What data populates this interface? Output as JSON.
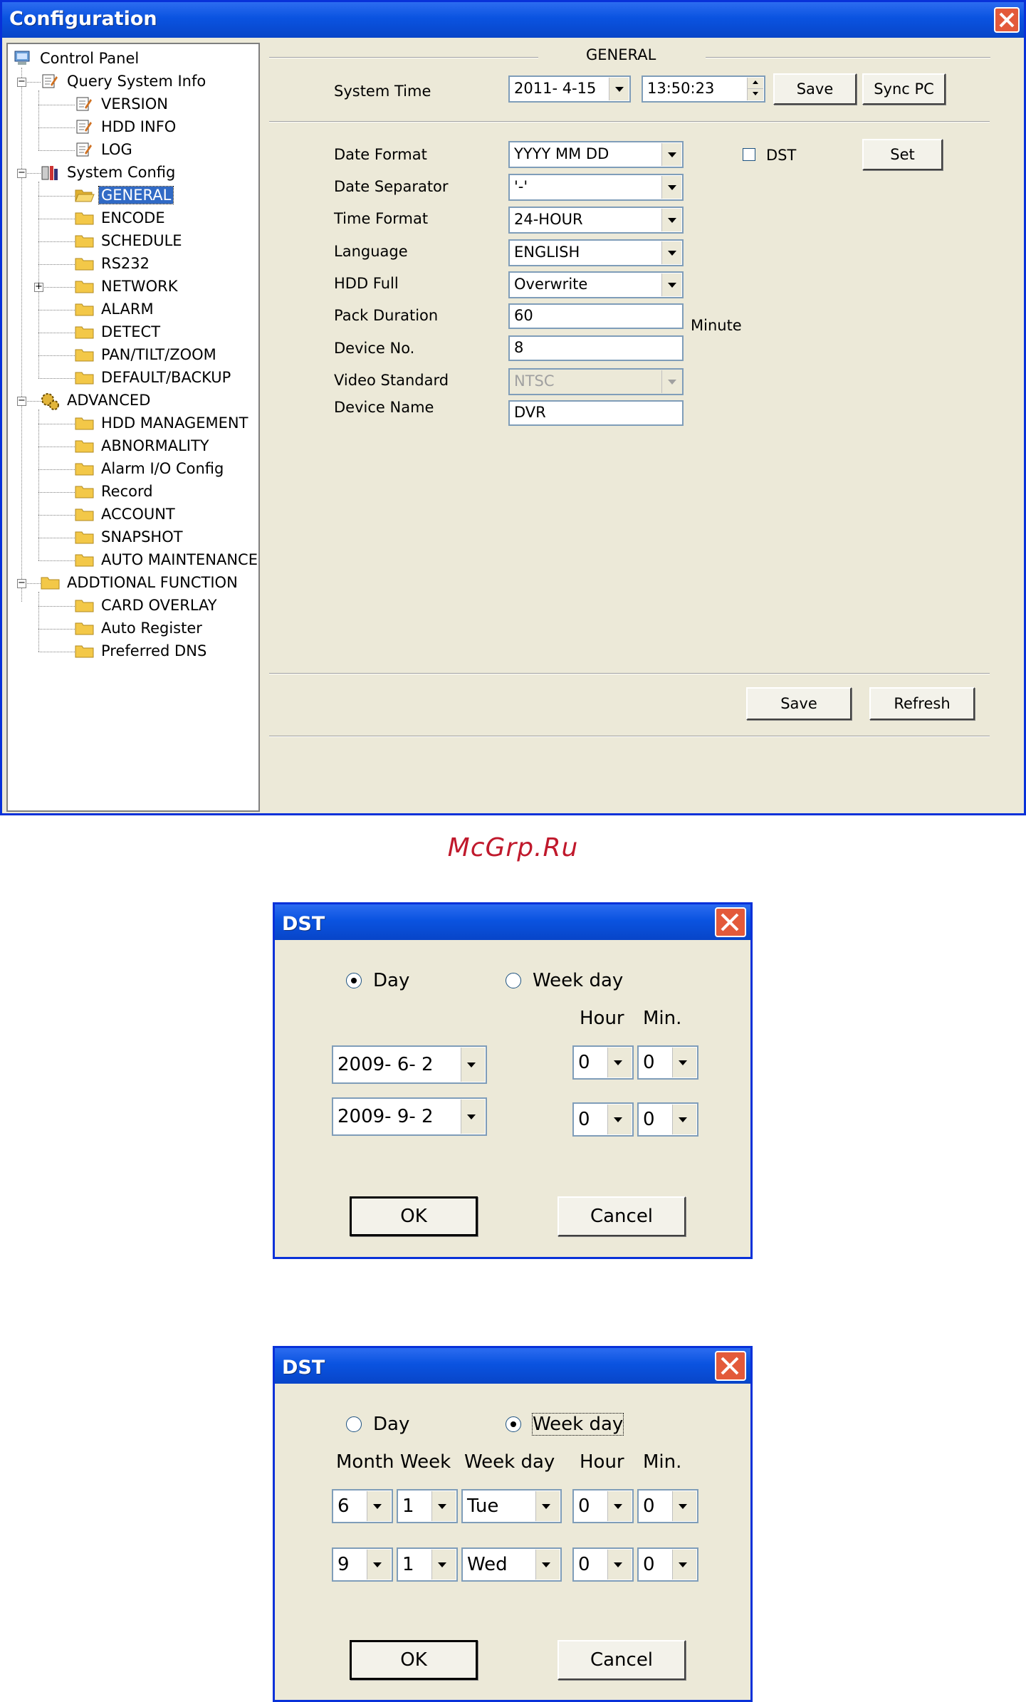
{
  "config": {
    "title": "Configuration",
    "tree": [
      {
        "label": "Control Panel",
        "level": 0,
        "icon": "computer-icon"
      },
      {
        "label": "Query System Info",
        "level": 1,
        "icon": "notepad-icon"
      },
      {
        "label": "VERSION",
        "level": 2,
        "icon": "notepad-icon"
      },
      {
        "label": "HDD INFO",
        "level": 2,
        "icon": "notepad-icon"
      },
      {
        "label": "LOG",
        "level": 2,
        "icon": "notepad-icon"
      },
      {
        "label": "System Config",
        "level": 1,
        "icon": "tools-icon"
      },
      {
        "label": "GENERAL",
        "level": 2,
        "icon": "folder-open-icon",
        "selected": true
      },
      {
        "label": "ENCODE",
        "level": 2,
        "icon": "folder-icon"
      },
      {
        "label": "SCHEDULE",
        "level": 2,
        "icon": "folder-icon"
      },
      {
        "label": "RS232",
        "level": 2,
        "icon": "folder-icon"
      },
      {
        "label": "NETWORK",
        "level": 2,
        "icon": "folder-icon",
        "expander": "+"
      },
      {
        "label": "ALARM",
        "level": 2,
        "icon": "folder-icon"
      },
      {
        "label": "DETECT",
        "level": 2,
        "icon": "folder-icon"
      },
      {
        "label": "PAN/TILT/ZOOM",
        "level": 2,
        "icon": "folder-icon"
      },
      {
        "label": "DEFAULT/BACKUP",
        "level": 2,
        "icon": "folder-icon"
      },
      {
        "label": "ADVANCED",
        "level": 1,
        "icon": "gears-icon"
      },
      {
        "label": "HDD MANAGEMENT",
        "level": 2,
        "icon": "folder-icon"
      },
      {
        "label": "ABNORMALITY",
        "level": 2,
        "icon": "folder-icon"
      },
      {
        "label": "Alarm I/O Config",
        "level": 2,
        "icon": "folder-icon"
      },
      {
        "label": "Record",
        "level": 2,
        "icon": "folder-icon"
      },
      {
        "label": "ACCOUNT",
        "level": 2,
        "icon": "folder-icon"
      },
      {
        "label": "SNAPSHOT",
        "level": 2,
        "icon": "folder-icon"
      },
      {
        "label": "AUTO MAINTENANCE",
        "level": 2,
        "icon": "folder-icon"
      },
      {
        "label": "ADDTIONAL FUNCTION",
        "level": 1,
        "icon": "folder-icon"
      },
      {
        "label": "CARD OVERLAY",
        "level": 2,
        "icon": "folder-icon"
      },
      {
        "label": "Auto Register",
        "level": 2,
        "icon": "folder-icon"
      },
      {
        "label": "Preferred DNS",
        "level": 2,
        "icon": "folder-icon"
      }
    ],
    "section_title": "GENERAL",
    "system_time": {
      "label": "System Time",
      "date": "2011- 4-15",
      "time": "13:50:23",
      "save": "Save",
      "sync": "Sync PC"
    },
    "fields": {
      "date_format": {
        "label": "Date Format",
        "value": "YYYY MM DD"
      },
      "date_separator": {
        "label": "Date Separator",
        "value": "'-'"
      },
      "time_format": {
        "label": "Time Format",
        "value": "24-HOUR"
      },
      "language": {
        "label": "Language",
        "value": "ENGLISH"
      },
      "hdd_full": {
        "label": "HDD Full",
        "value": "Overwrite"
      },
      "pack_duration": {
        "label": "Pack Duration",
        "value": "60",
        "unit": "Minute"
      },
      "device_no": {
        "label": "Device No.",
        "value": "8"
      },
      "video_standard": {
        "label": "Video Standard",
        "value": "NTSC"
      },
      "device_name": {
        "label": "Device Name",
        "value": "DVR"
      }
    },
    "dst": {
      "label": "DST",
      "set": "Set"
    },
    "footer": {
      "save": "Save",
      "refresh": "Refresh"
    }
  },
  "watermark": "McGrp.Ru",
  "dst_day": {
    "title": "DST",
    "day_label": "Day",
    "weekday_label": "Week day",
    "hour_label": "Hour",
    "min_label": "Min.",
    "start_date": "2009- 6- 2",
    "end_date": "2009- 9- 2",
    "start_hour": "0",
    "start_min": "0",
    "end_hour": "0",
    "end_min": "0",
    "ok": "OK",
    "cancel": "Cancel"
  },
  "dst_week": {
    "title": "DST",
    "day_label": "Day",
    "weekday_label": "Week day",
    "month_label": "Month",
    "week_label": "Week",
    "weekday_col_label": "Week day",
    "hour_label": "Hour",
    "min_label": "Min.",
    "start": {
      "month": "6",
      "week": "1",
      "weekday": "Tue",
      "hour": "0",
      "min": "0"
    },
    "end": {
      "month": "9",
      "week": "1",
      "weekday": "Wed",
      "hour": "0",
      "min": "0"
    },
    "ok": "OK",
    "cancel": "Cancel"
  }
}
